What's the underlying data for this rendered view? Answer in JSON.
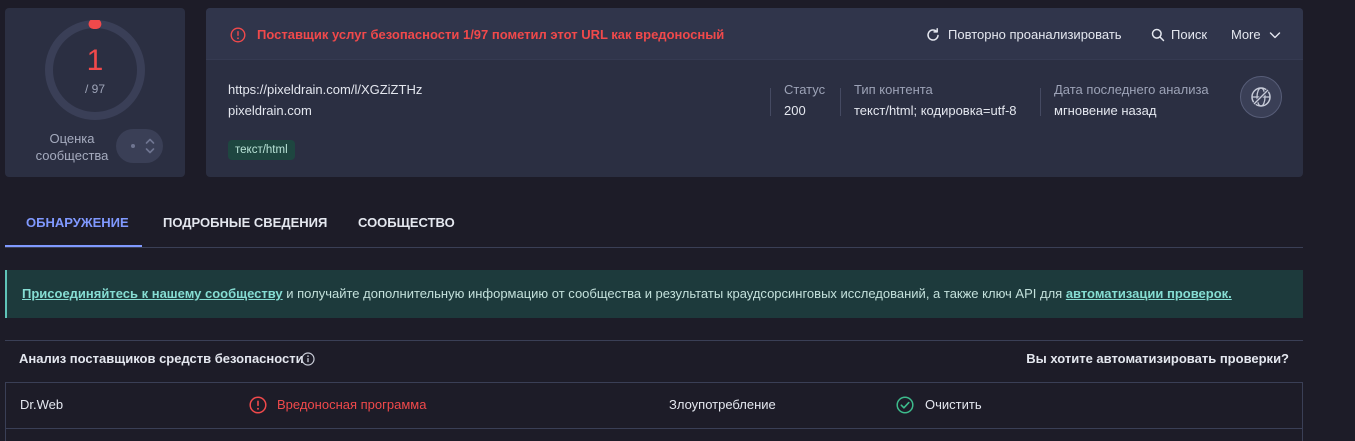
{
  "community_score": {
    "positives": "1",
    "total_label": "/ 97",
    "label_line1": "Оценка",
    "label_line2": "сообщества"
  },
  "alert": {
    "icon": "alert-circle-icon",
    "text": "Поставщик услуг безопасности 1/97 пометил этот URL как вредоносный"
  },
  "actions": {
    "reanalyze": {
      "icon": "refresh-icon",
      "label": "Повторно проанализировать"
    },
    "search": {
      "icon": "search-icon",
      "label": "Поиск"
    },
    "more": {
      "icon": "chevron-down-icon",
      "label": "More"
    }
  },
  "target": {
    "url": "https://pixeldrain.com/l/XGZiZTHz",
    "domain": "pixeldrain.com",
    "tags": [
      "текст/html"
    ]
  },
  "meta": [
    {
      "label": "Статус",
      "value": "200"
    },
    {
      "label": "Тип контента",
      "value": "текст/html; кодировка=utf-8"
    },
    {
      "label": "Дата последнего анализа",
      "value": "мгновение назад"
    }
  ],
  "globe_icon": "globe-icon",
  "tabs": [
    {
      "label": "ОБНАРУЖЕНИЕ",
      "active": true
    },
    {
      "label": "ПОДРОБНЫЕ СВЕДЕНИЯ",
      "active": false
    },
    {
      "label": "СООБЩЕСТВО",
      "active": false
    }
  ],
  "banner": {
    "link_join": "Присоединяйтесь к нашему сообществу",
    "text": " и получайте дополнительную информацию от сообщества и результаты краудсорсинговых исследований, а также ключ API для ",
    "link_automation": "автоматизации проверок."
  },
  "vendors_section": {
    "title": "Анализ поставщиков средств безопасности",
    "info_icon": "info-icon",
    "automate_prompt": "Вы хотите автоматизировать проверки?"
  },
  "vendors": [
    {
      "name": "Dr.Web",
      "result": "Вредоносная программа",
      "malicious": true,
      "icon": "alert-circle-icon"
    },
    {
      "name": "Злоупотребление",
      "result": "Очистить",
      "malicious": false,
      "icon": "check-circle-icon"
    }
  ],
  "colors": {
    "malicious": "#f0494b",
    "clean": "#3dbb8c",
    "accent": "#8099ff",
    "banner_link": "#86ddd3"
  }
}
